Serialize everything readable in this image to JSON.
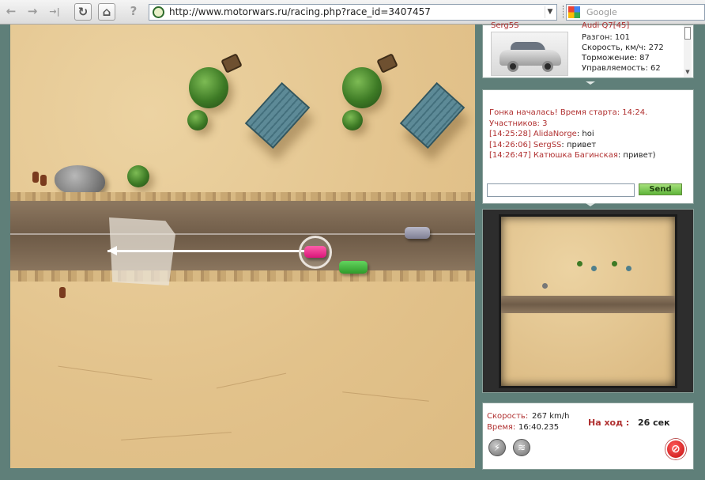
{
  "browser": {
    "url": "http://www.motorwars.ru/racing.php?race_id=3407457",
    "search_placeholder": "Google",
    "back_icon": "←",
    "forward_icon": "→",
    "skip_icon": "→|",
    "reload_icon": "↻",
    "home_icon": "⌂",
    "info_icon": "?",
    "dropdown_icon": "▼"
  },
  "car_info": {
    "owner": "Serg5S",
    "model": "Audi Q7[45]",
    "stats": [
      "Разгон: 101",
      "Скорость, км/ч: 272",
      "Торможение: 87",
      "Управляемость: 62"
    ]
  },
  "chat": {
    "system_lines": [
      "Гонка началась! Время старта: 14:24.",
      "Участников: 3"
    ],
    "messages": [
      {
        "time": "[14:25:28]",
        "user": "AlidaNorge",
        "text": "hoi"
      },
      {
        "time": "[14:26:06]",
        "user": "SergSS",
        "text": "привет"
      },
      {
        "time": "[14:26:47]",
        "user": "Катюшка Багинская",
        "text": "привет)"
      }
    ],
    "input_value": "",
    "send_label": "Send"
  },
  "status": {
    "speed_label": "Скорость:",
    "speed_value": "267 km/h",
    "time_label": "Время:",
    "time_value": "16:40.235",
    "turn_label": "На ход :",
    "turn_value": "26 сек",
    "quit_icon": "⊘",
    "nitro_icon": "⚡",
    "radar_icon": "≋"
  },
  "colors": {
    "sand": "#e2c28b",
    "road": "#7a6651",
    "player_car": "#e0207f",
    "opponent_grey": "#9a9aae",
    "opponent_green": "#3fb23a",
    "panel_bg": "#5f7f79",
    "accent_red": "#b03030"
  }
}
